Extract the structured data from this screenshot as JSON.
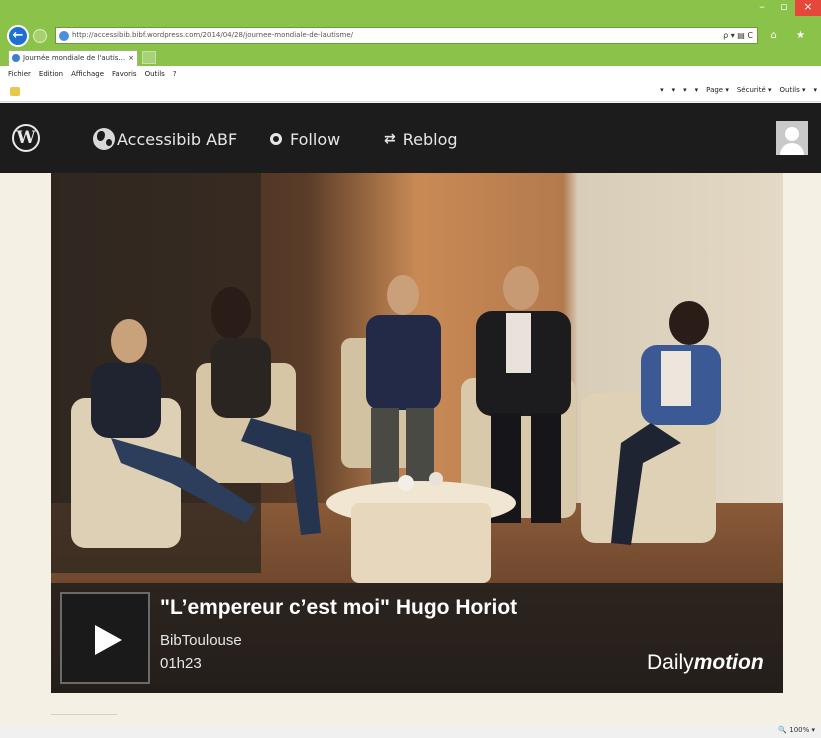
{
  "browser": {
    "address": "http://accessibib.bibf.wordpress.com/2014/04/28/journee-mondiale-de-lautisme/",
    "address_actions": "ρ ▾ ▤ C",
    "home_star": "⌂ ★",
    "tab_title": "Journée mondiale de l'autis...",
    "tab_close": "×",
    "window_controls": [
      "–",
      "▫",
      "×"
    ],
    "menu": [
      "Fichier",
      "Edition",
      "Affichage",
      "Favoris",
      "Outils",
      "?"
    ],
    "command_items": [
      "▾",
      "▾",
      "▾",
      "▾",
      "Page ▾",
      "Sécurité ▾",
      "Outils ▾",
      "▾"
    ],
    "zoom": "🔍 100% ▾"
  },
  "wpbar": {
    "logo": "W",
    "site_name": "Accessibib ABF",
    "follow": "Follow",
    "reblog": "Reblog",
    "reblog_icon": "⇄"
  },
  "video": {
    "title": "\"L’empereur c’est moi\" Hugo Horiot",
    "channel": "BibToulouse",
    "duration": "01h23",
    "provider_light": "Daily",
    "provider_bold": "motion"
  },
  "colors": {
    "chrome": "#8bc34a",
    "admin_bar": "#1c1c1c",
    "page_bg": "#f4f1e4"
  }
}
